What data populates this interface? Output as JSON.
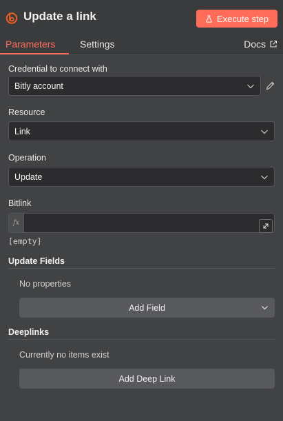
{
  "header": {
    "title": "Update a link",
    "execute_label": "Execute step",
    "logo_icon": "bitly-logo-icon",
    "accent": "#ff6d5a"
  },
  "tabs": [
    {
      "label": "Parameters",
      "active": true
    },
    {
      "label": "Settings",
      "active": false
    }
  ],
  "docs_label": "Docs",
  "fields": {
    "credential": {
      "label": "Credential to connect with",
      "value": "Bitly account"
    },
    "resource": {
      "label": "Resource",
      "value": "Link"
    },
    "operation": {
      "label": "Operation",
      "value": "Update"
    },
    "bitlink": {
      "label": "Bitlink",
      "value": "",
      "fx_label": "fx",
      "hint": "[empty]"
    }
  },
  "update_fields": {
    "title": "Update Fields",
    "empty_text": "No properties",
    "add_label": "Add Field"
  },
  "deeplinks": {
    "title": "Deeplinks",
    "empty_text": "Currently no items exist",
    "add_label": "Add Deep Link"
  }
}
